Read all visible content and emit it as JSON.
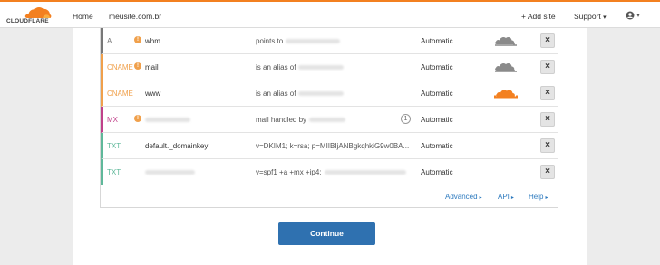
{
  "brand": {
    "name": "CLOUDFLARE",
    "accent": "#f38020"
  },
  "nav": {
    "home": "Home",
    "site": "meusite.com.br",
    "add_site": "+ Add site",
    "support": "Support",
    "support_caret": "▾",
    "user_caret": "▾",
    "user_icon": "user-icon"
  },
  "records": [
    {
      "type": "A",
      "type_color": "#777777",
      "warn": true,
      "name": "whm",
      "value": "points to",
      "ttl": "Automatic",
      "proxy": "grey-cloud",
      "delete": "×"
    },
    {
      "type": "CNAME",
      "type_color": "#f0a04b",
      "warn": true,
      "name": "mail",
      "value": "is an alias of",
      "ttl": "Automatic",
      "proxy": "grey-cloud",
      "delete": "×"
    },
    {
      "type": "CNAME",
      "type_color": "#f0a04b",
      "warn": false,
      "name": "www",
      "value": "is an alias of",
      "ttl": "Automatic",
      "proxy": "orange-cloud",
      "delete": "×"
    },
    {
      "type": "MX",
      "type_color": "#c0408a",
      "warn": true,
      "name": "",
      "value": "mail handled by",
      "priority": "1",
      "ttl": "Automatic",
      "proxy": "",
      "delete": "×"
    },
    {
      "type": "TXT",
      "type_color": "#5fb89a",
      "warn": false,
      "name": "default._domainkey",
      "value": "v=DKIM1; k=rsa; p=MIIBIjANBgkqhkiG9w0BA...",
      "ttl": "Automatic",
      "proxy": "",
      "delete": "×"
    },
    {
      "type": "TXT",
      "type_color": "#5fb89a",
      "warn": false,
      "name": "",
      "value": "v=spf1 +a +mx +ip4:",
      "ttl": "Automatic",
      "proxy": "",
      "delete": "×"
    }
  ],
  "footer": {
    "advanced": "Advanced",
    "api": "API",
    "help": "Help",
    "caret": "▸"
  },
  "continue_label": "Continue"
}
